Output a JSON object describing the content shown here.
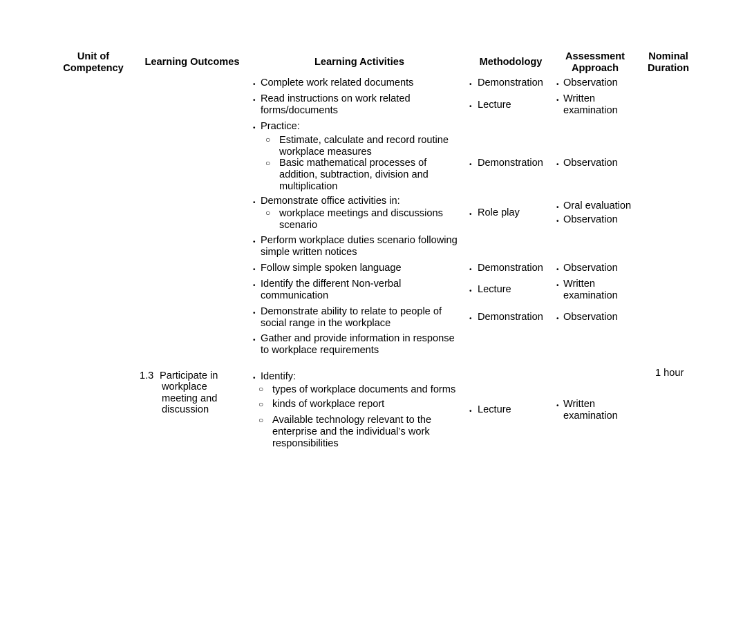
{
  "headers": {
    "unit": "Unit of Competency",
    "unit_l1": "Unit of",
    "unit_l2": "Competency",
    "outcomes": "Learning Outcomes",
    "activities": "Learning Activities",
    "methodology": "Methodology",
    "assessment_l1": "Assessment",
    "assessment_l2": "Approach",
    "duration_l1": "Nominal",
    "duration_l2": "Duration"
  },
  "bullet_glyph": "•",
  "sub_bullet_glyph": "○",
  "activities": {
    "a1": "Complete work related documents",
    "a2_l1": "Read instructions on work related",
    "a2_l2": "forms/documents",
    "a3": "Practice:",
    "a3_s1_l1": "Estimate, calculate and record routine",
    "a3_s1_l2": "workplace measures",
    "a3_s2_l1": "Basic mathematical processes of",
    "a3_s2_l2": "addition, subtraction, division and",
    "a3_s2_l3": "multiplication",
    "a4": "Demonstrate office activities in:",
    "a4_s1_l1": "workplace meetings and discussions",
    "a4_s1_l2": "scenario",
    "a5_l1": "Perform workplace duties scenario following",
    "a5_l2": "simple written notices",
    "a6": "Follow simple spoken language",
    "a7_l1": "Identify the different Non-verbal",
    "a7_l2": "communication",
    "a8_l1": "Demonstrate ability to relate to people of",
    "a8_l2": "social range in the workplace",
    "a9_l1": "Gather and provide information in response",
    "a9_l2": "to workplace requirements",
    "b1": "Identify:",
    "b1_s1": "types of workplace  documents and forms",
    "b1_s2": "kinds of workplace report",
    "b1_s3_l1": "Available technology relevant to the",
    "b1_s3_l2": "enterprise and the individual’s work",
    "b1_s3_l3": "responsibilities"
  },
  "methodology": {
    "m1": "Demonstration",
    "m2": "Lecture",
    "m3": "Demonstration",
    "m4": "Role play",
    "m5": "Demonstration",
    "m6": "Lecture",
    "m7": "Demonstration",
    "m8": "Lecture"
  },
  "assessment": {
    "s1": "Observation",
    "s2_l1": "Written",
    "s2_l2": "examination",
    "s3": "Observation",
    "s4a": "Oral evaluation",
    "s4b": "Observation",
    "s5": "Observation",
    "s6_l1": "Written",
    "s6_l2": "examination",
    "s7": "Observation",
    "s8_l1": "Written",
    "s8_l2": "examination"
  },
  "outcome_13": {
    "number": "1.3",
    "l1": "Participate  in",
    "l2": "workplace",
    "l3": "meeting and",
    "l4": "discussion"
  },
  "duration_13": "1 hour"
}
